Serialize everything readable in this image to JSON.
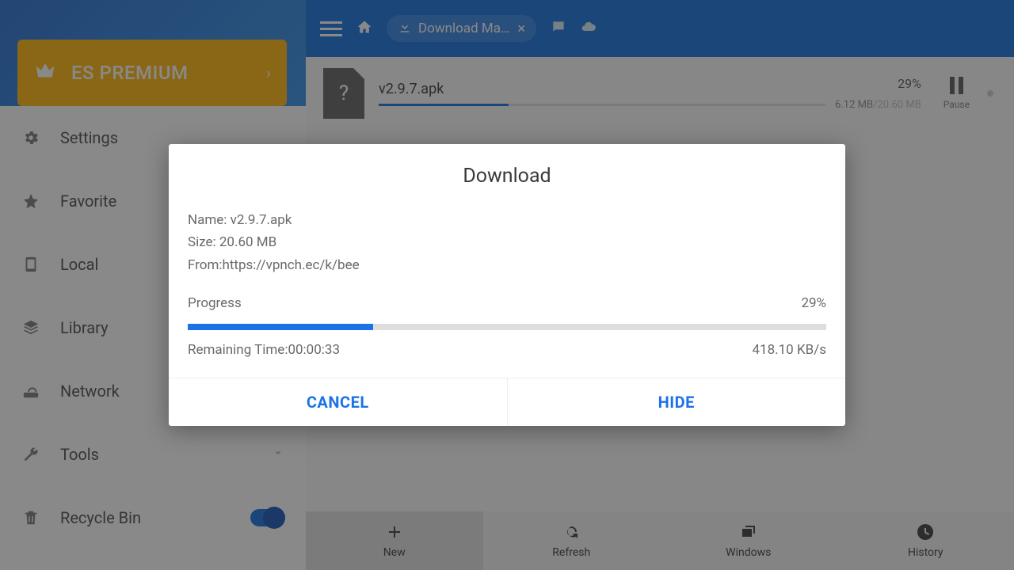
{
  "topbar": {
    "tab_label": "Download Ma…"
  },
  "premium": {
    "label": "ES PREMIUM"
  },
  "sidebar": {
    "items": [
      {
        "label": "Settings"
      },
      {
        "label": "Favorite"
      },
      {
        "label": "Local"
      },
      {
        "label": "Library"
      },
      {
        "label": "Network"
      },
      {
        "label": "Tools"
      },
      {
        "label": "Recycle Bin"
      }
    ]
  },
  "download_item": {
    "name": "v2.9.7.apk",
    "percent": "29%",
    "percent_num": 29,
    "done_size": "6.12 MB",
    "total_size": "/20.60 MB",
    "pause_label": "Pause"
  },
  "bottombar": {
    "items": [
      {
        "label": "New"
      },
      {
        "label": "Refresh"
      },
      {
        "label": "Windows"
      },
      {
        "label": "History"
      }
    ]
  },
  "dialog": {
    "title": "Download",
    "name_row": "Name: v2.9.7.apk",
    "size_row": "Size: 20.60 MB",
    "from_row": "From:https://vpnch.ec/k/bee",
    "progress_label": "Progress",
    "progress_pct": "29%",
    "progress_num": 29,
    "remaining_label": "Remaining Time:00:00:33",
    "speed": "418.10 KB/s",
    "cancel": "CANCEL",
    "hide": "HIDE"
  }
}
